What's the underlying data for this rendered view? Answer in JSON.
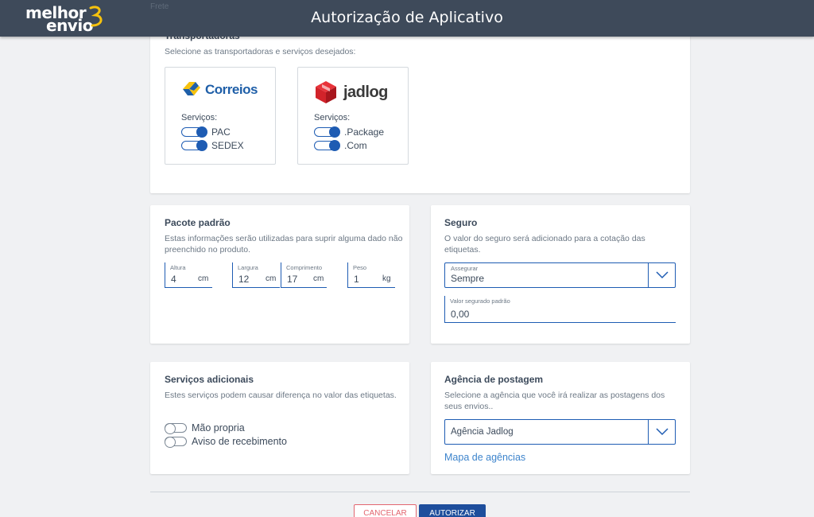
{
  "header": {
    "logo_line1": "melhor",
    "logo_line2": "envio",
    "title": "Autorização de Aplicativo"
  },
  "peek_text": "Frete",
  "carriers_card": {
    "title": "Transportadoras",
    "description": "Selecione as transportadoras e serviços desejados:",
    "carriers": [
      {
        "name": "Correios",
        "services_label": "Serviços:",
        "services": [
          {
            "label": "PAC",
            "enabled": true
          },
          {
            "label": "SEDEX",
            "enabled": true
          }
        ]
      },
      {
        "name": "jadlog",
        "services_label": "Serviços:",
        "services": [
          {
            "label": ".Package",
            "enabled": true
          },
          {
            "label": ".Com",
            "enabled": true
          }
        ]
      }
    ]
  },
  "package_card": {
    "title": "Pacote padrão",
    "description": "Estas informações serão utilizadas para suprir alguma dado não preenchido no produto.",
    "fields": [
      {
        "label": "Altura",
        "value": "4",
        "unit": "cm"
      },
      {
        "label": "Largura",
        "value": "12",
        "unit": "cm"
      },
      {
        "label": "Comprimento",
        "value": "17",
        "unit": "cm"
      },
      {
        "label": "Peso",
        "value": "1",
        "unit": "kg"
      }
    ]
  },
  "insurance_card": {
    "title": "Seguro",
    "description": "O valor do seguro será adicionado para a cotação das etiquetas.",
    "assegurar_label": "Assegurar",
    "assegurar_value": "Sempre",
    "valor_label": "Valor segurado padrão",
    "valor_value": "0,00"
  },
  "extra_services_card": {
    "title": "Serviços adicionais",
    "description": "Estes serviços podem causar diferença no valor das etiquetas.",
    "options": [
      {
        "label": "Mão propria",
        "enabled": false
      },
      {
        "label": "Aviso de recebimento",
        "enabled": false
      }
    ]
  },
  "agency_card": {
    "title": "Agência de postagem",
    "description": "Selecione a agência que você irá realizar as postagens dos seus envios..",
    "select_value": "Agência Jadlog",
    "map_link": "Mapa de agências"
  },
  "actions": {
    "cancel_label": "CANCELAR",
    "authorize_label": "AUTORIZAR"
  },
  "colors": {
    "header_bg": "#3e4a5a",
    "accent": "#1e5cb3",
    "cancel": "#e26670",
    "jadlog_red": "#d2232a",
    "correios_yellow": "#f6c20e",
    "correios_blue": "#1f5fa8"
  }
}
